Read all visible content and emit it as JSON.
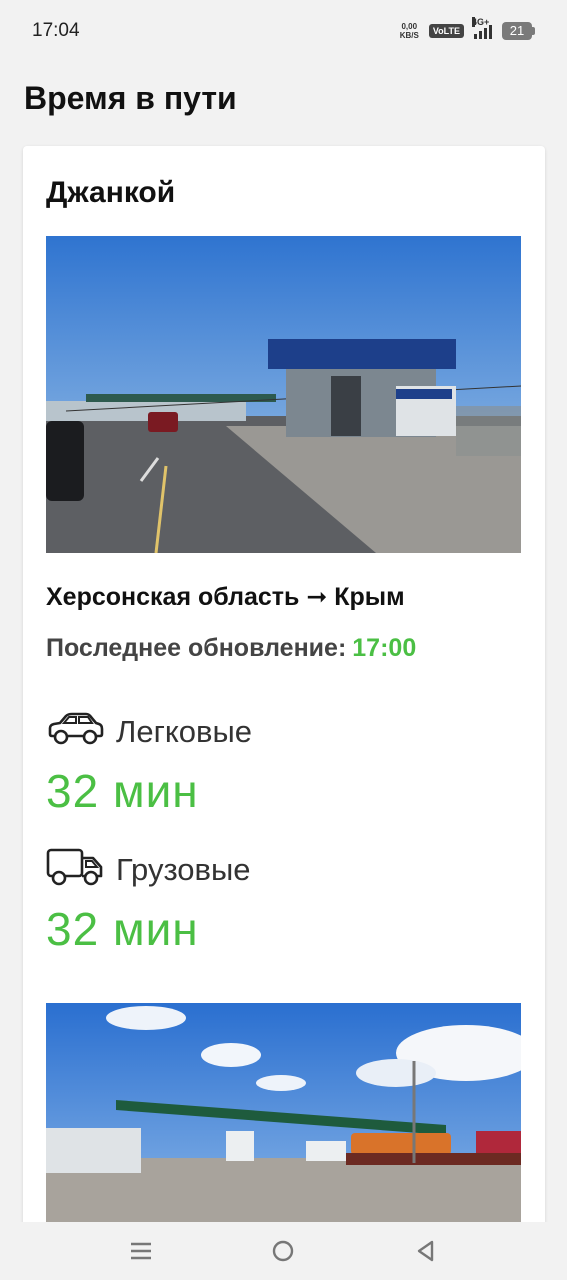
{
  "status": {
    "time": "17:04",
    "netspeed_value": "0,00",
    "netspeed_unit": "KB/S",
    "volte": "VoLTE",
    "network": "4G+",
    "battery": "21"
  },
  "page": {
    "title": "Время в пути"
  },
  "card": {
    "city": "Джанкой",
    "route": "Херсонская область ➞ Крым",
    "updated_label": "Последнее обновление:",
    "updated_time": "17:00",
    "cars": {
      "icon": "car-icon",
      "label": "Легковые",
      "duration": "32 мин"
    },
    "trucks": {
      "icon": "truck-icon",
      "label": "Грузовые",
      "duration": "32 мин"
    }
  },
  "nav": {
    "items": [
      "menu-icon",
      "home-icon",
      "back-icon"
    ]
  },
  "colors": {
    "accent_green": "#4bbf44",
    "background": "#f2f2f2",
    "card": "#ffffff"
  }
}
